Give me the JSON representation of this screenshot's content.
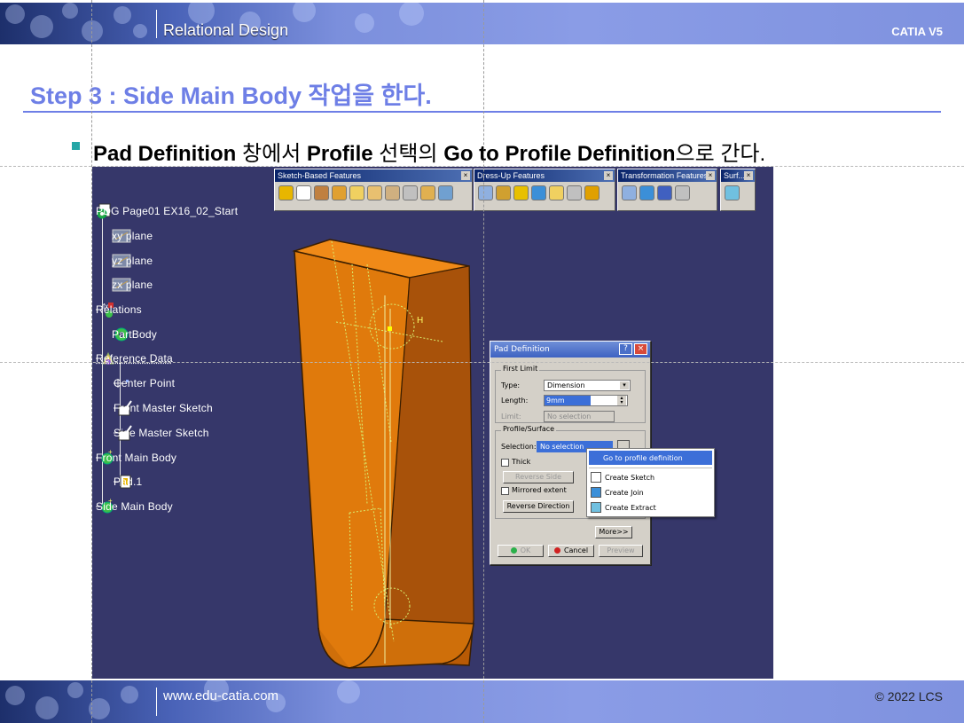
{
  "header": {
    "title": "Relational Design",
    "product": "CATIA V5"
  },
  "footer": {
    "url": "www.edu-catia.com",
    "copyright": "© 2022 LCS"
  },
  "step": {
    "title": "Step 3 : Side Main Body 작업을 한다."
  },
  "instruction": {
    "b1": "Pad Definition",
    "t1": " 창에서 ",
    "b2": "Profile",
    "t2": " 선택의 ",
    "b3": "Go to Profile Definition",
    "t3": "으로 간다."
  },
  "toolbars": [
    {
      "title": "Sketch-Based Features"
    },
    {
      "title": "Dress-Up Features"
    },
    {
      "title": "Transformation Features"
    },
    {
      "title": "Surf..."
    }
  ],
  "tree": {
    "root": "PDG Page01 EX16_02_Start",
    "items": [
      "xy plane",
      "yz plane",
      "zx plane",
      "Relations",
      "PartBody",
      "Reference Data",
      "Center Point",
      "Front Master Sketch",
      "Side Master Sketch",
      "Front Main Body",
      "Pad.1",
      "Side Main Body"
    ]
  },
  "viewport_label": "H",
  "dialog": {
    "title": "Pad Definition",
    "first_limit": "First Limit",
    "type_label": "Type:",
    "type_value": "Dimension",
    "length_label": "Length:",
    "length_value": "9mm",
    "limit_label": "Limit:",
    "limit_value": "No selection",
    "profile_surface": "Profile/Surface",
    "selection_label": "Selection:",
    "selection_value": "No selection",
    "thick": "Thick",
    "reverse_side": "Reverse Side",
    "mirrored_extent": "Mirrored extent",
    "reverse_direction": "Reverse Direction",
    "more": "More>>",
    "ok": "OK",
    "cancel": "Cancel",
    "preview": "Preview"
  },
  "context_menu": {
    "items": [
      "Go to profile definition",
      "Create Sketch",
      "Create Join",
      "Create Extract"
    ]
  },
  "colors": {
    "accent": "#6e7fe6",
    "viewport": "#36376a",
    "part": "#e07a0c"
  }
}
